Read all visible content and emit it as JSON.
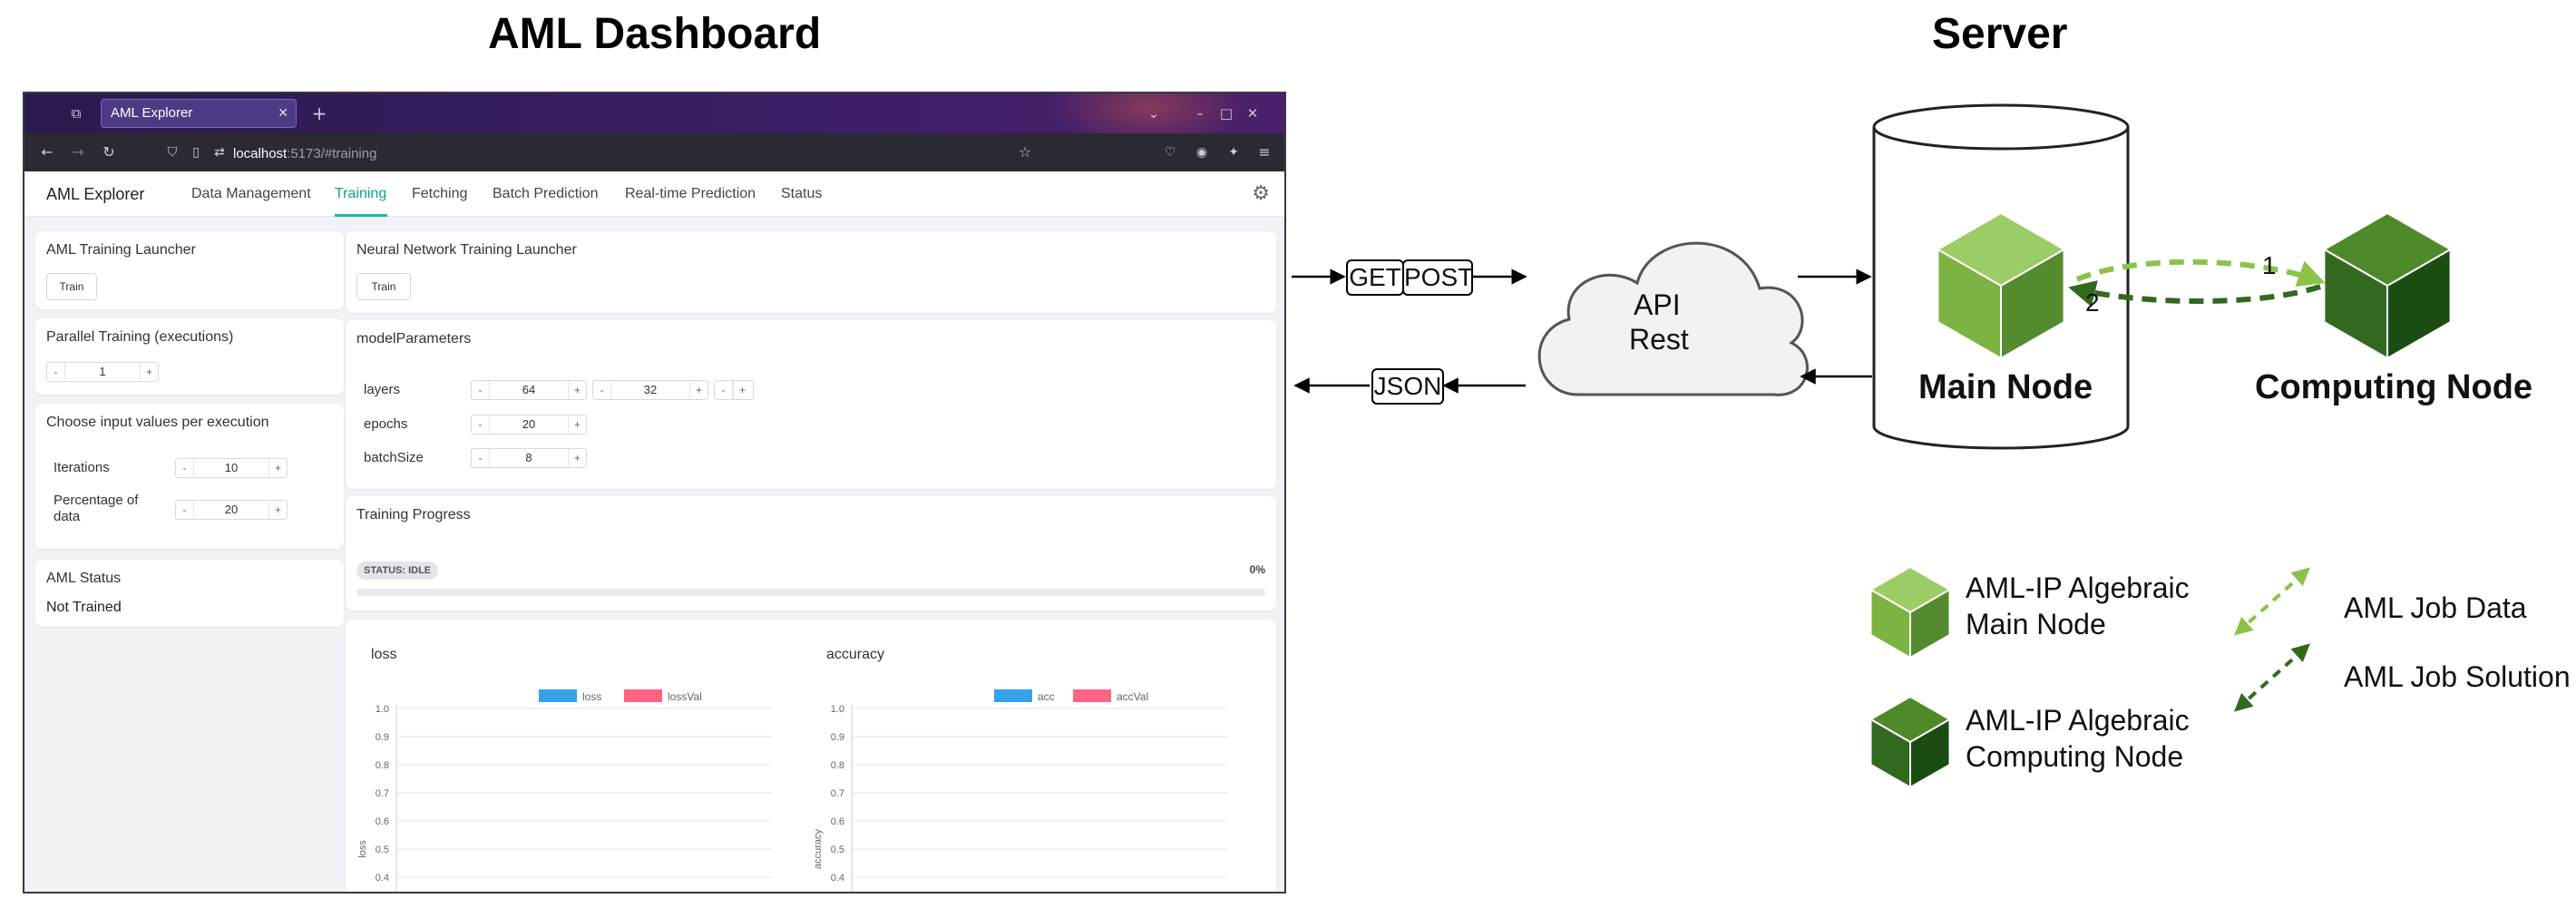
{
  "titles": {
    "dashboard": "AML Dashboard",
    "server": "Server"
  },
  "browser": {
    "tab_title": "AML Explorer",
    "url_host": "localhost",
    "url_path": ":5173/#training"
  },
  "app": {
    "brand": "AML Explorer",
    "nav": [
      "Data Management",
      "Training",
      "Fetching",
      "Batch Prediction",
      "Real-time Prediction",
      "Status"
    ],
    "active_nav": "Training"
  },
  "aml_training": {
    "title": "AML Training Launcher",
    "button": "Train"
  },
  "parallel": {
    "title": "Parallel Training (executions)",
    "value": "1"
  },
  "input_values": {
    "title": "Choose input values per execution",
    "iterations_label": "Iterations",
    "iterations_value": "10",
    "percentage_label_line1": "Percentage of",
    "percentage_label_line2": "data",
    "percentage_value": "20"
  },
  "aml_status": {
    "title": "AML Status",
    "value": "Not Trained"
  },
  "nn_training": {
    "title": "Neural Network Training Launcher",
    "button": "Train"
  },
  "model_params": {
    "title": "modelParameters",
    "layers_label": "layers",
    "layers_values": [
      "64",
      "32",
      ""
    ],
    "epochs_label": "epochs",
    "epochs_value": "20",
    "batch_label": "batchSize",
    "batch_value": "8"
  },
  "progress": {
    "title": "Training Progress",
    "status": "STATUS: IDLE",
    "percent": "0%",
    "fraction": 0
  },
  "stepper_symbols": {
    "minus": "-",
    "plus": "+"
  },
  "chart_data": [
    {
      "type": "line",
      "title": "loss",
      "ylabel": "loss",
      "legend": [
        "loss",
        "lossVal"
      ],
      "legend_colors": [
        "#36a2eb",
        "#ff6384"
      ],
      "ylim": [
        0,
        1
      ],
      "visible_ticks": [
        "1.0",
        "0.9",
        "0.8",
        "0.7",
        "0.6",
        "0.5",
        "0.4"
      ],
      "series": [
        {
          "name": "loss",
          "values": []
        },
        {
          "name": "lossVal",
          "values": []
        }
      ]
    },
    {
      "type": "line",
      "title": "accuracy",
      "ylabel": "accuracy",
      "legend": [
        "acc",
        "accVal"
      ],
      "legend_colors": [
        "#36a2eb",
        "#ff6384"
      ],
      "ylim": [
        0,
        1
      ],
      "visible_ticks": [
        "1.0",
        "0.9",
        "0.8",
        "0.7",
        "0.6",
        "0.5",
        "0.4"
      ],
      "series": [
        {
          "name": "acc",
          "values": []
        },
        {
          "name": "accVal",
          "values": []
        }
      ]
    }
  ],
  "diagram": {
    "get": "GET",
    "post": "POST",
    "json": "JSON",
    "api_line1": "API",
    "api_line2": "Rest",
    "main_node": "Main Node",
    "computing_node": "Computing Node",
    "step1": "1",
    "step2": "2",
    "legend_main_line1": "AML-IP Algebraic",
    "legend_main_line2": "Main Node",
    "legend_comp_line1": "AML-IP Algebraic",
    "legend_comp_line2": "Computing Node",
    "legend_job_data": "AML Job Data",
    "legend_job_solution": "AML Job Solution"
  },
  "colors": {
    "main_node": "#7cb342",
    "main_node_top": "#9ccc65",
    "main_node_side": "#558b2f",
    "computing_node": "#33691e",
    "computing_node_top": "#4e8a2a",
    "computing_node_side": "#1b4d12",
    "job_data_arrow": "#8bc34a",
    "job_solution_arrow": "#33691e",
    "accent": "#14b8a6"
  }
}
